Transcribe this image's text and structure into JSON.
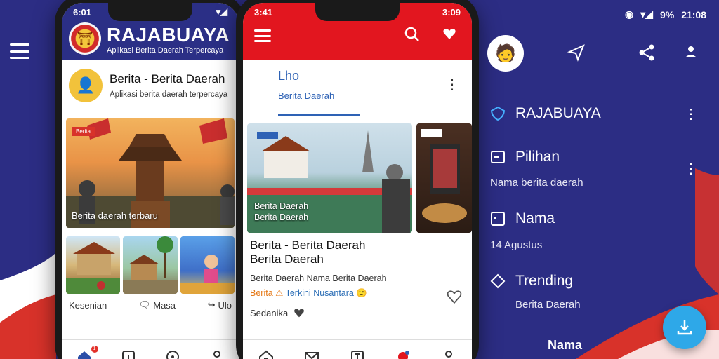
{
  "colors": {
    "background_navy": "#2c2d84",
    "header_blue": "#2b2f86",
    "header_red": "#e2161f",
    "accent_blue": "#2e62b5",
    "fab_blue": "#2ea8e8"
  },
  "phone1": {
    "status_time": "6:01",
    "brand": "RAJABUAYA",
    "tagline": "Aplikasi Berita Daerah Terpercaya",
    "profile": {
      "title": "Berita - Berita Daerah",
      "subtitle": "Aplikasi berita daerah terpercaya"
    },
    "hero": {
      "badge": "Berita",
      "caption": "Berita daerah terbaru"
    },
    "thumbs": [
      {
        "label": "Kesenian",
        "icon": ""
      },
      {
        "label": "Masa",
        "icon": "chat-icon"
      },
      {
        "label": "Ulo",
        "icon": "share-icon"
      }
    ],
    "nav": [
      {
        "icon": "home-icon",
        "badge": "1"
      },
      {
        "icon": "square-icon",
        "badge": ""
      },
      {
        "icon": "location-icon",
        "badge": ""
      },
      {
        "icon": "person-icon",
        "badge": ""
      }
    ]
  },
  "phone2": {
    "status_time": "3:41",
    "status_right": "3:09",
    "section": {
      "title": "Lho",
      "subtitle": "Berita Daerah"
    },
    "main_image_caption": [
      "Berita Daerah",
      "Berita Daerah"
    ],
    "article": {
      "headline_line1": "Berita - Berita Daerah",
      "headline_line2": "Berita Daerah",
      "description": "Berita Daerah Nama Berita Daerah",
      "meta_orange": "Berita",
      "meta_blue": "Terkini",
      "meta_blue2": "Nusantara",
      "source": "Sedanika"
    },
    "nav": [
      {
        "icon": "home-icon"
      },
      {
        "icon": "mail-icon"
      },
      {
        "icon": "text-icon"
      },
      {
        "icon": "notification-icon"
      },
      {
        "icon": "person-icon"
      }
    ]
  },
  "right_panel": {
    "status": {
      "battery": "9%",
      "time": "21:08"
    },
    "items": [
      {
        "label": "RAJABUAYA",
        "icon": "shield-icon"
      },
      {
        "label": "Pilihan",
        "icon": "minus-box-icon"
      },
      {
        "label": "Nama",
        "icon": "square-icon"
      },
      {
        "label": "Trending",
        "icon": "clock-icon"
      }
    ],
    "subtitles": [
      "Nama berita daerah",
      "14 Agustus",
      "Berita Daerah"
    ],
    "bottom_label": "Nama"
  }
}
